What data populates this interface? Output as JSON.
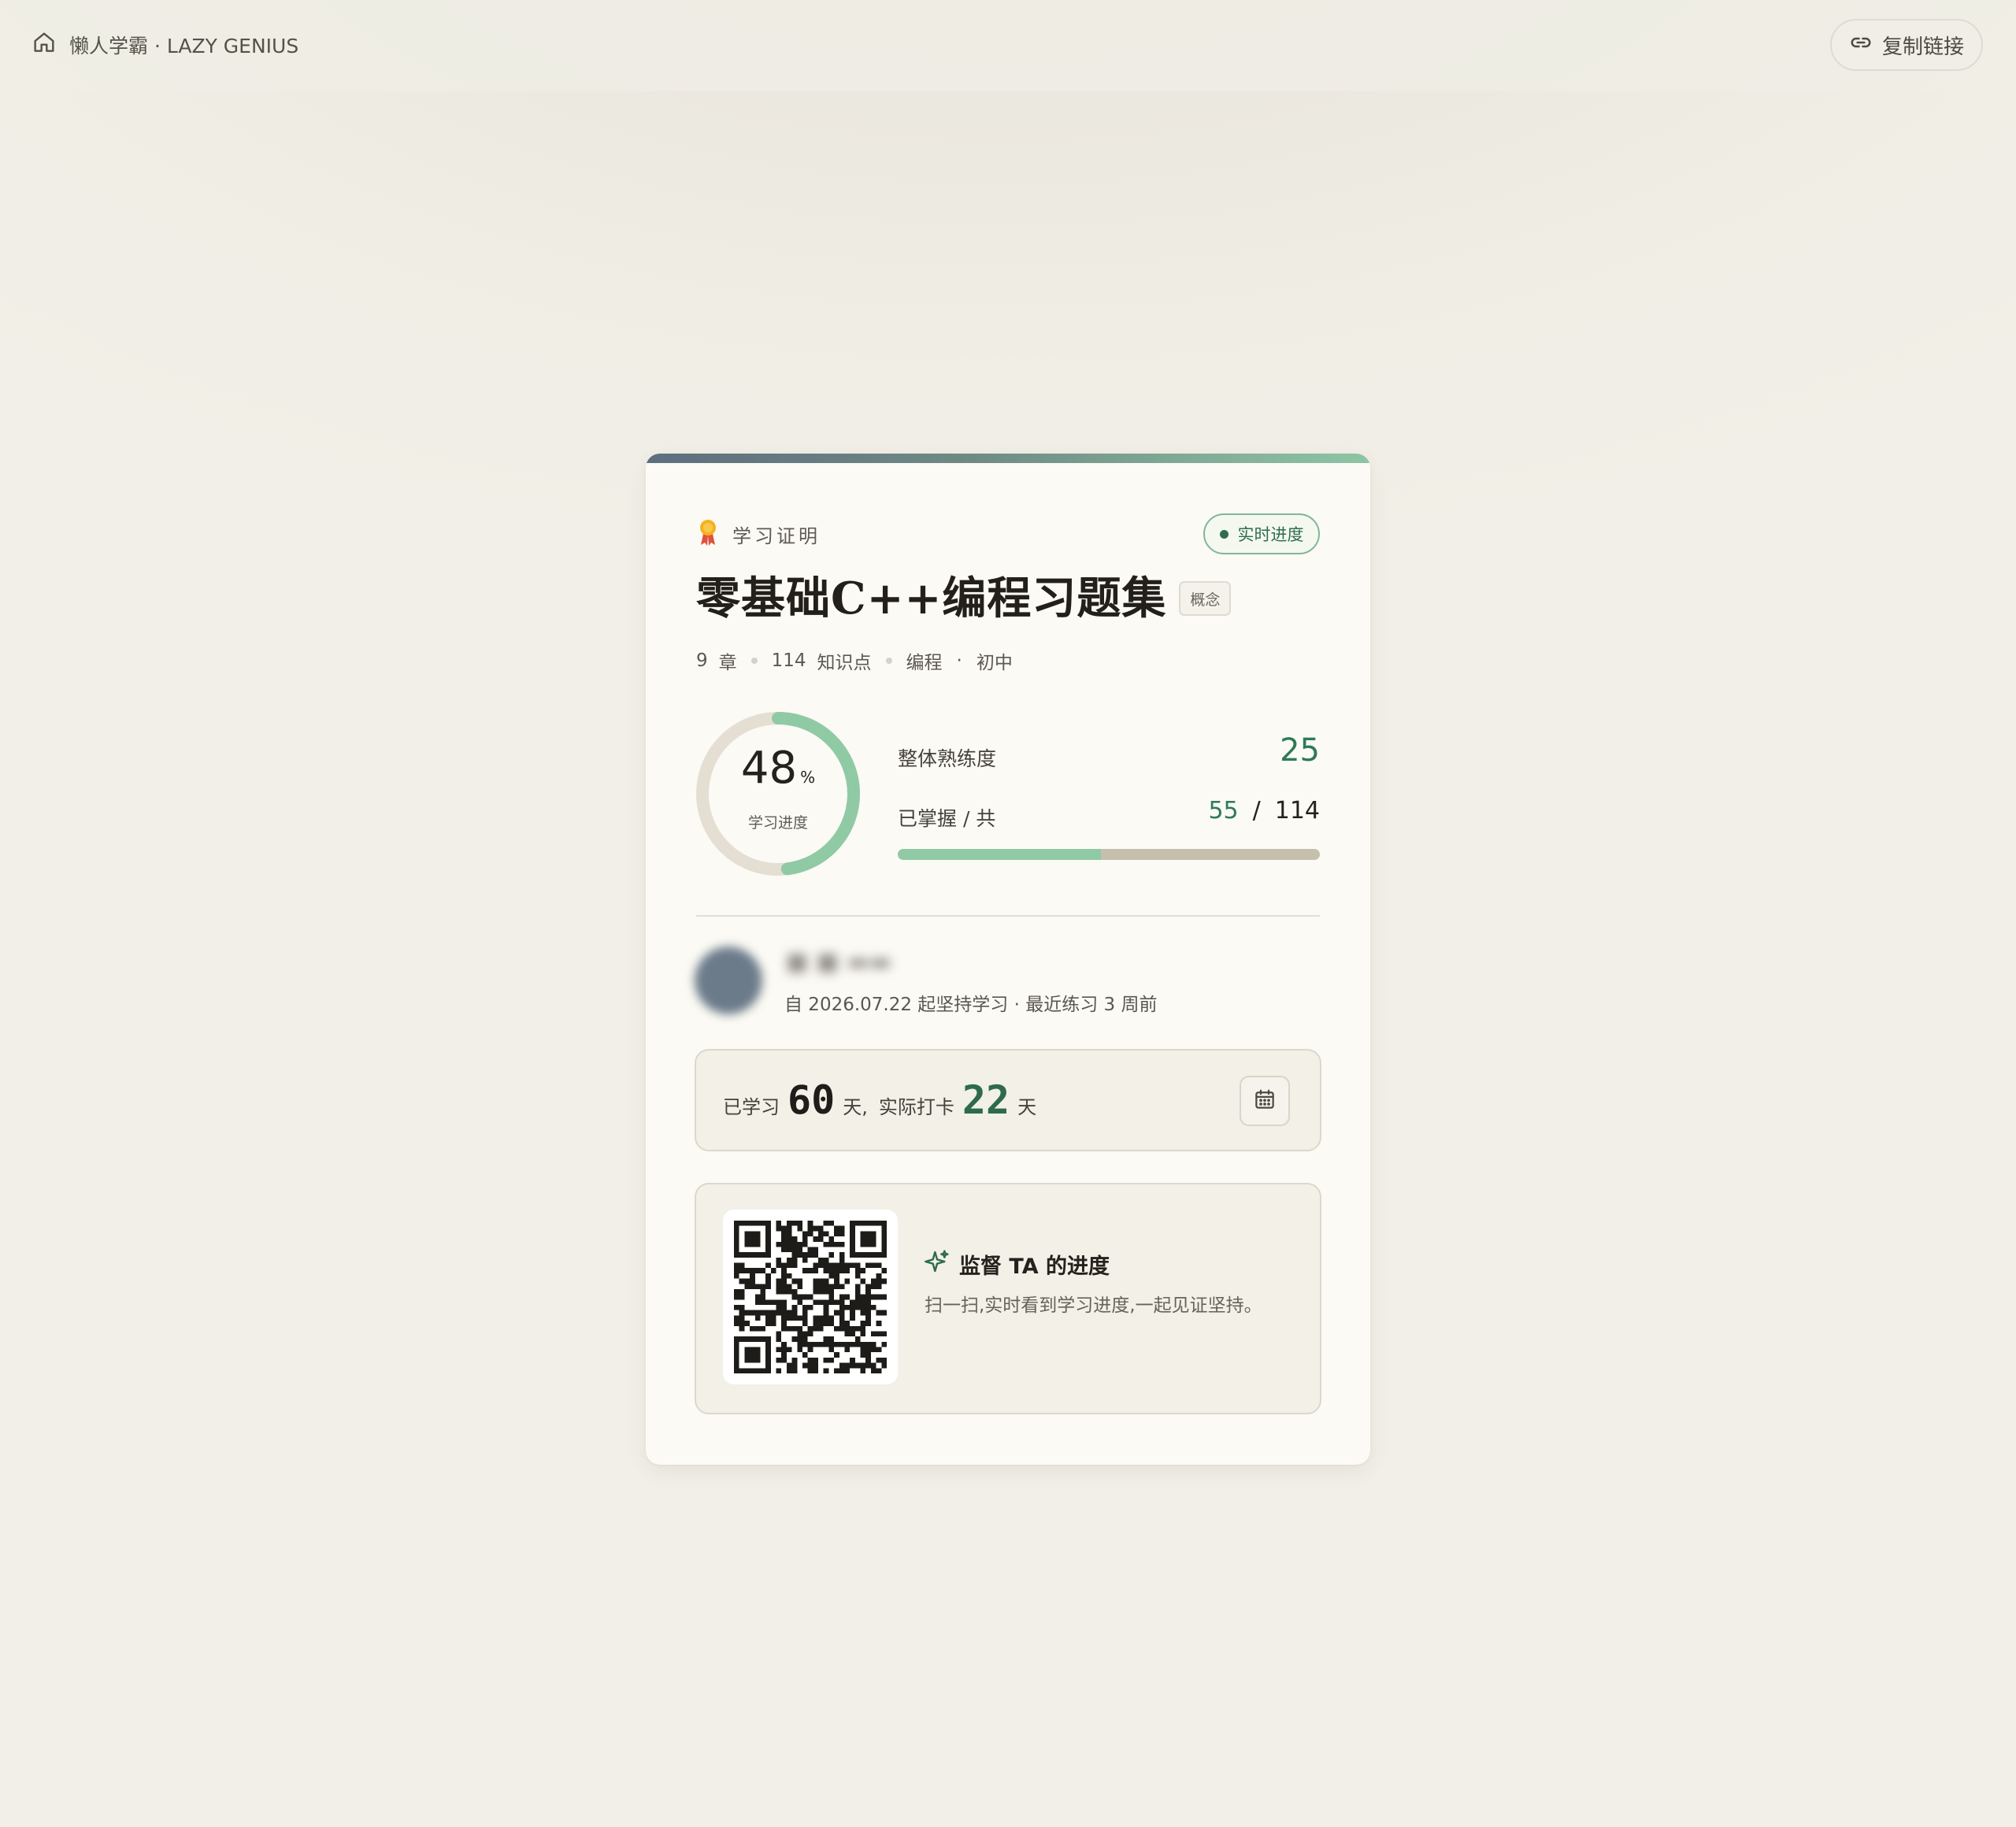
{
  "header": {
    "brand": "懒人学霸 · LAZY GENIUS",
    "copy_link": "复制链接"
  },
  "card": {
    "cert_label": "学习证明",
    "live_badge": "实时进度",
    "course_title": "零基础C++编程习题集",
    "tag": "概念",
    "meta": {
      "chapters_count": "9",
      "chapters_unit": "章",
      "points_count": "114",
      "points_unit": "知识点",
      "subject": "编程",
      "dot": "·",
      "level": "初中"
    },
    "progress": {
      "percent_value": 48,
      "percent": "48",
      "percent_unit": "%",
      "label": "学习进度"
    },
    "mastery": {
      "label": "整体熟练度",
      "value": "25"
    },
    "mastered": {
      "label": "已掌握 / 共",
      "done": "55",
      "sep": "/",
      "total": "114",
      "fraction": 0.482
    },
    "user": {
      "since": "自 2026.07.22 起坚持学习 · 最近练习 3 周前"
    },
    "stats": {
      "studied_prefix": "已学习",
      "studied_days": "60",
      "studied_suffix": "天,",
      "checkin_prefix": "实际打卡",
      "checkin_days": "22",
      "checkin_suffix": "天"
    },
    "qr": {
      "title": "监督 TA 的进度",
      "desc": "扫一扫,实时看到学习进度,一起见证坚持。"
    }
  },
  "colors": {
    "accent_green": "#2e7a55",
    "ring_green": "#8fcaa5",
    "ring_track": "#e4dfd2",
    "bar_track": "#c6bfad"
  },
  "icons": {
    "home": "home-icon",
    "link": "link-icon",
    "medal": "medal-icon",
    "calendar": "calendar-icon",
    "sparkle": "sparkle-icon"
  }
}
